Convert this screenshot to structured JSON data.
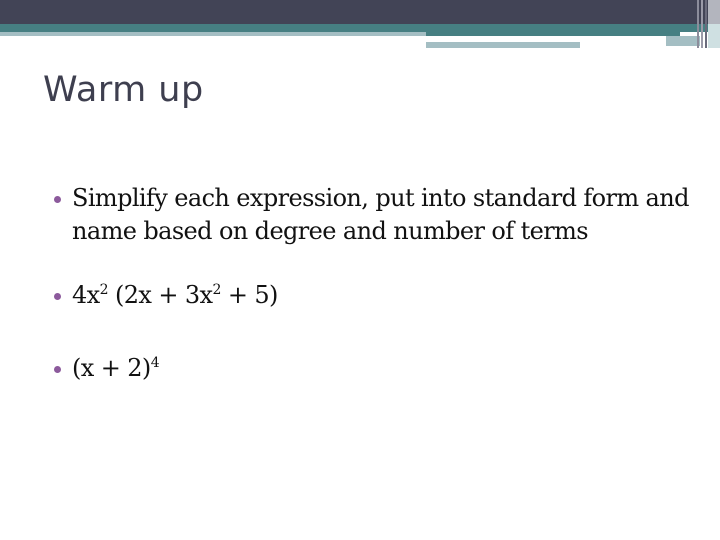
{
  "slide": {
    "title": "Warm up",
    "bullets": [
      {
        "text": "Simplify each expression, put into standard form and name based on degree and number of terms"
      },
      {
        "parts": [
          "4x",
          "2",
          " (2x + 3x",
          "2",
          " + 5)"
        ]
      },
      {
        "parts": [
          "(x + 2)",
          "4"
        ]
      }
    ],
    "colors": {
      "header_dark": "#424456",
      "header_teal": "#467f82",
      "header_light": "#a4bec3",
      "bullet": "#8c5a9c",
      "title": "#3e3f4f"
    }
  }
}
